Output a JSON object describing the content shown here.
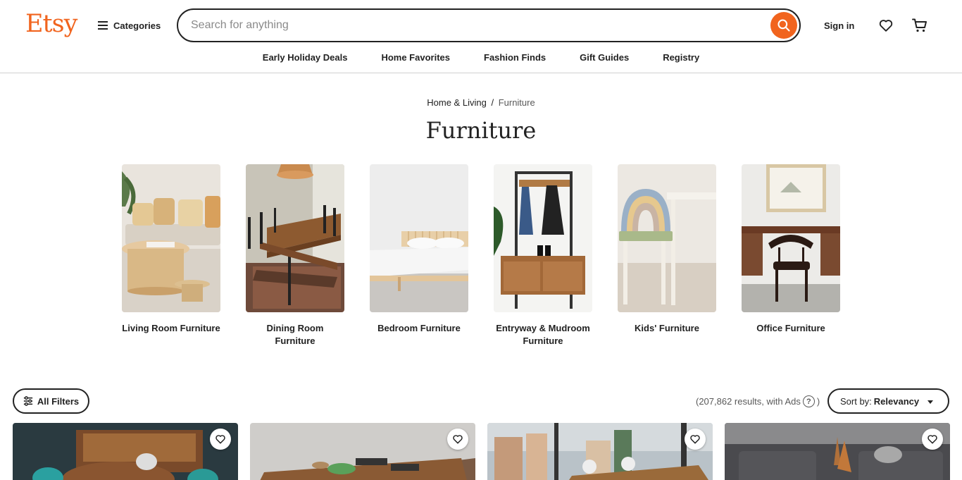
{
  "header": {
    "logo": "Etsy",
    "categories_label": "Categories",
    "search_placeholder": "Search for anything",
    "sign_in_label": "Sign in"
  },
  "nav": {
    "items": [
      "Early Holiday Deals",
      "Home Favorites",
      "Fashion Finds",
      "Gift Guides",
      "Registry"
    ]
  },
  "breadcrumb": {
    "parent": "Home & Living",
    "separator": "/",
    "current": "Furniture"
  },
  "page_title": "Furniture",
  "categories": [
    {
      "label": "Living Room Furniture"
    },
    {
      "label": "Dining Room Furniture"
    },
    {
      "label": "Bedroom Furniture"
    },
    {
      "label": "Entryway & Mudroom Furniture"
    },
    {
      "label": "Kids' Furniture"
    },
    {
      "label": "Office Furniture"
    }
  ],
  "filters": {
    "all_filters_label": "All Filters",
    "results_text": "(207,862 results, with Ads",
    "results_close": ")",
    "help_glyph": "?",
    "sort_prefix": "Sort by:",
    "sort_value": "Relevancy"
  },
  "colors": {
    "brand": "#f1641e",
    "text": "#222222"
  }
}
